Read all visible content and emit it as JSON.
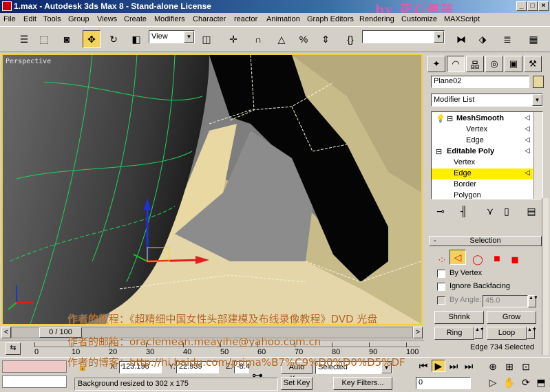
{
  "titlebar": {
    "title": "1.max - Autodesk 3ds Max 8  - Stand-alone License",
    "banner": "by 花心男孩"
  },
  "menu": [
    "File",
    "Edit",
    "Tools",
    "Group",
    "Views",
    "Create",
    "Modifiers",
    "Character",
    "reactor",
    "Animation",
    "Graph Editors",
    "Rendering",
    "Customize",
    "MAXScript"
  ],
  "toolbar": {
    "ref_coord": "View"
  },
  "viewport": {
    "label": "Perspective"
  },
  "panel": {
    "object_name": "Plane02",
    "object_color": "#e8d8a0",
    "modifier_list": "Modifier List",
    "stack": [
      {
        "label": "MeshSmooth",
        "level": 0,
        "bold": true
      },
      {
        "label": "Vertex",
        "level": 1
      },
      {
        "label": "Edge",
        "level": 1
      },
      {
        "label": "Editable Poly",
        "level": 0,
        "bold": true
      },
      {
        "label": "Vertex",
        "level": 1
      },
      {
        "label": "Edge",
        "level": 1,
        "selected": true
      },
      {
        "label": "Border",
        "level": 1
      },
      {
        "label": "Polygon",
        "level": 1
      }
    ],
    "selection": {
      "title": "Selection",
      "by_vertex": "By Vertex",
      "ignore_backfacing": "Ignore Backfacing",
      "by_angle": "By Angle:",
      "angle_value": "45.0",
      "shrink": "Shrink",
      "grow": "Grow",
      "ring": "Ring",
      "loop": "Loop",
      "status": "Edge 734 Selected"
    }
  },
  "timeline": {
    "frame": "0 / 100",
    "ticks": [
      "0",
      "10",
      "20",
      "30",
      "40",
      "50",
      "60",
      "70",
      "80",
      "90",
      "100"
    ]
  },
  "status": {
    "x_label": "X:",
    "x_value": "123.198",
    "y_label": "Y:",
    "y_value": "22.939",
    "z_label": "Z:",
    "z_value": "-8.4",
    "auto_key": "Auto Key",
    "set_key": "Set Key",
    "selected": "Selected",
    "key_filters": "Key Filters...",
    "frame_field": "0",
    "prompt": "Background resized to 302 x 175"
  },
  "watermark": {
    "line1": "作者的教程：《超精细中国女性头部建模及布线录像教程》DVD 光盘",
    "line2": "作者的邮箱：oraclemean.meayihe@yahoo.com.cn",
    "line3": "作者的博客：http://hi.baidu.com/prima%B7%C9%D0%D0%D5%DF"
  },
  "colors": {
    "title_start": "#0a246a",
    "active_viewport_border": "#f0d040",
    "stack_selection": "#ffee00",
    "selection_active": "#f3d35a",
    "watermark": "#b06020"
  }
}
